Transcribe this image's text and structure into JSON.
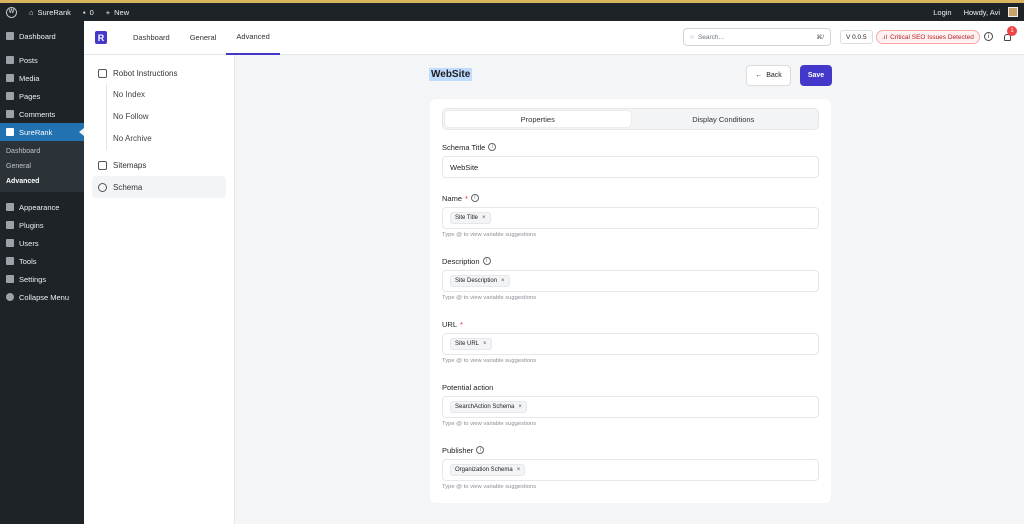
{
  "adminbar": {
    "site_name": "SureRank",
    "comments_count": "0",
    "new_label": "New",
    "login_label": "Login",
    "howdy_label": "Howdy, Avi"
  },
  "sidebar": {
    "items_top": [
      {
        "label": "Dashboard",
        "icon": "dashboard-icon"
      }
    ],
    "items_main": [
      {
        "label": "Posts",
        "icon": "pin-icon"
      },
      {
        "label": "Media",
        "icon": "media-icon"
      },
      {
        "label": "Pages",
        "icon": "pages-icon"
      },
      {
        "label": "Comments",
        "icon": "comments-icon"
      }
    ],
    "active": {
      "label": "SureRank",
      "icon": "surerank-icon"
    },
    "submenu": [
      "Dashboard",
      "General",
      "Advanced"
    ],
    "items_bottom": [
      {
        "label": "Appearance",
        "icon": "appearance-icon"
      },
      {
        "label": "Plugins",
        "icon": "plugins-icon"
      },
      {
        "label": "Users",
        "icon": "users-icon"
      },
      {
        "label": "Tools",
        "icon": "tools-icon"
      },
      {
        "label": "Settings",
        "icon": "settings-icon"
      },
      {
        "label": "Collapse Menu",
        "icon": "collapse-icon"
      }
    ]
  },
  "topnav": {
    "tabs": [
      "Dashboard",
      "General",
      "Advanced"
    ],
    "active_tab": "Advanced",
    "search_placeholder": "Search...",
    "search_shortcut": "⌘/",
    "version": "V 0.0.5",
    "critical_label": "Critical SEO Issues Detected",
    "notif_count": "1"
  },
  "leftnav": {
    "robot": "Robot Instructions",
    "robot_sub": [
      "No Index",
      "No Follow",
      "No Archive"
    ],
    "sitemaps": "Sitemaps",
    "schema": "Schema"
  },
  "main": {
    "title": "WebSite",
    "back_label": "Back",
    "save_label": "Save",
    "tabs": [
      "Properties",
      "Display Conditions"
    ],
    "schema_title_label": "Schema Title",
    "schema_title_value": "WebSite",
    "hint": "Type @ to view variable suggestions",
    "fields": [
      {
        "label": "Name",
        "required": "*",
        "info": true,
        "chip": "Site Title"
      },
      {
        "label": "Description",
        "required": "",
        "info": true,
        "chip": "Site Description"
      },
      {
        "label": "URL",
        "required": "*",
        "info": false,
        "chip": "Site URL"
      },
      {
        "label": "Potential action",
        "required": "",
        "info": false,
        "chip": "SearchAction Schema"
      },
      {
        "label": "Publisher",
        "required": "",
        "info": true,
        "chip": "Organization Schema"
      }
    ]
  },
  "colors": {
    "accent": "#4338ca",
    "wp_active": "#2271b1",
    "critical": "#b91c1c"
  }
}
